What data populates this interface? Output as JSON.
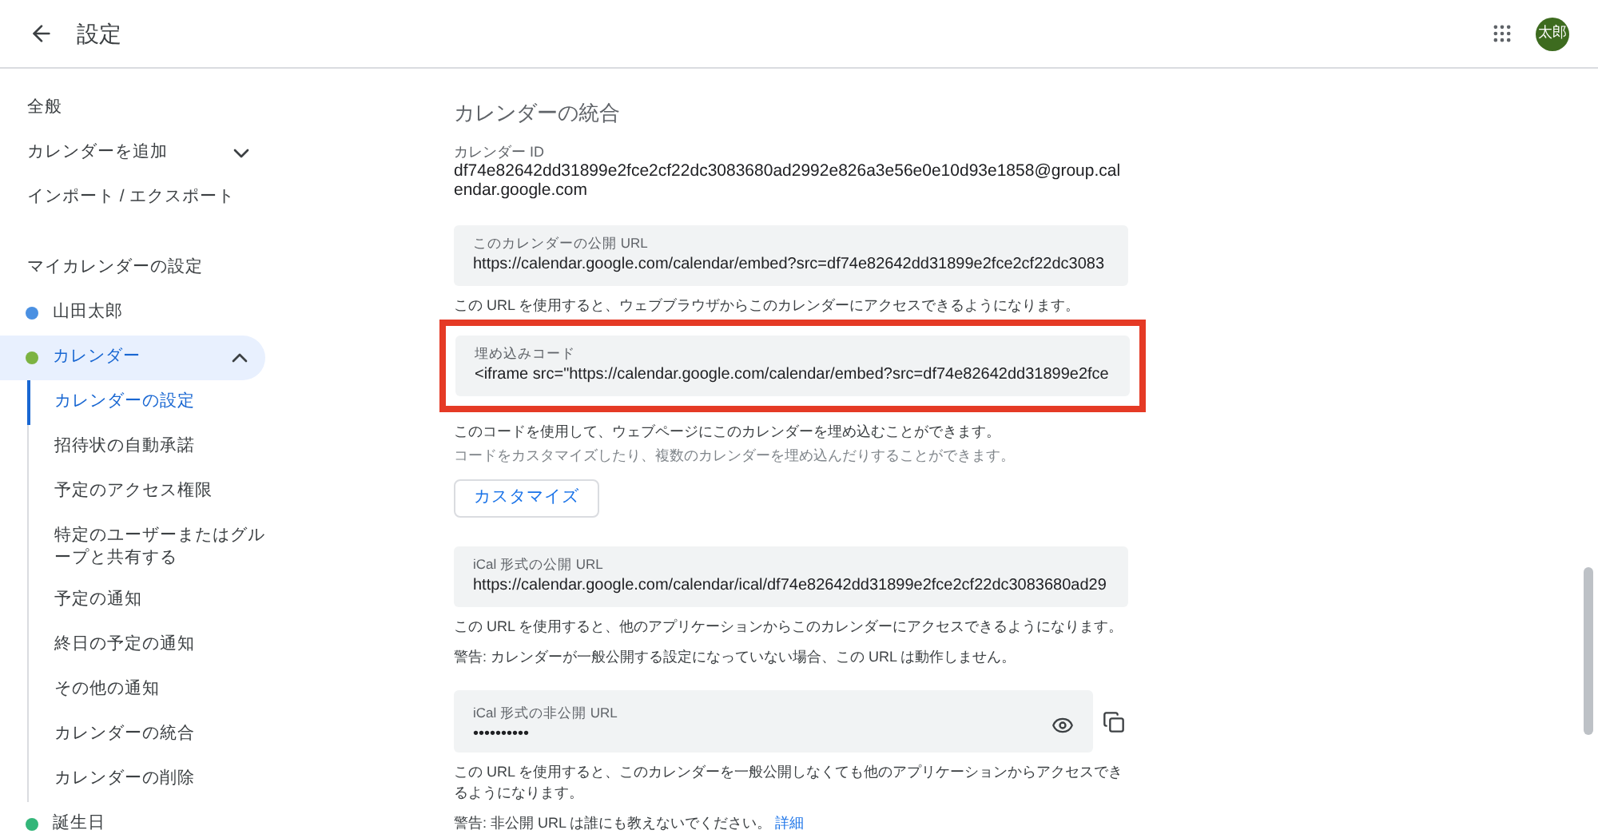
{
  "header": {
    "title": "設定",
    "avatar": "太郎"
  },
  "sidebar": {
    "top_items": [
      {
        "label": "全般"
      },
      {
        "label": "カレンダーを追加",
        "expanded": false
      },
      {
        "label": "インポート / エクスポート"
      }
    ],
    "section_title": "マイカレンダーの設定",
    "calendars": [
      {
        "label": "山田太郎",
        "color": "#4a90e2",
        "selected": false
      },
      {
        "label": "カレンダー",
        "color": "#7cb342",
        "selected": true,
        "expanded": true,
        "children": [
          {
            "label": "カレンダーの設定",
            "selected": true
          },
          {
            "label": "招待状の自動承諾",
            "selected": false
          },
          {
            "label": "予定のアクセス権限",
            "selected": false
          },
          {
            "label": "特定のユーザーまたはグループと共有する",
            "selected": false
          },
          {
            "label": "予定の通知",
            "selected": false
          },
          {
            "label": "終日の予定の通知",
            "selected": false
          },
          {
            "label": "その他の通知",
            "selected": false
          },
          {
            "label": "カレンダーの統合",
            "selected": false
          },
          {
            "label": "カレンダーの削除",
            "selected": false
          }
        ]
      },
      {
        "label": "誕生日",
        "color": "#33b679",
        "selected": false
      }
    ]
  },
  "content": {
    "title": "カレンダーの統合",
    "blocks": [
      {
        "kind": "info",
        "label": "カレンダー ID",
        "value": "df74e82642dd31899e2fce2cf22dc3083680ad2992e826a3e56e0e10d93e1858@group.calendar.google.com"
      },
      {
        "kind": "field",
        "label": "このカレンダーの公開 URL",
        "value": "https://calendar.google.com/calendar/embed?src=df74e82642dd31899e2fce2cf22dc3083",
        "highlighted": false
      },
      {
        "kind": "note",
        "text": "この URL を使用すると、ウェブブラウザからこのカレンダーにアクセスできるようになります。"
      },
      {
        "kind": "field",
        "label": "埋め込みコード",
        "value": "<iframe src=\"https://calendar.google.com/calendar/embed?src=df74e82642dd31899e2fce",
        "highlighted": true
      },
      {
        "kind": "note",
        "text": "このコードを使用して、ウェブページにこのカレンダーを埋め込むことができます。"
      },
      {
        "kind": "subnote",
        "text": "コードをカスタマイズしたり、複数のカレンダーを埋め込んだりすることができます。"
      },
      {
        "kind": "button",
        "label": "カスタマイズ"
      },
      {
        "kind": "field",
        "label": "iCal 形式の公開 URL",
        "value": "https://calendar.google.com/calendar/ical/df74e82642dd31899e2fce2cf22dc3083680ad29",
        "highlighted": false
      },
      {
        "kind": "note",
        "text": "この URL を使用すると、他のアプリケーションからこのカレンダーにアクセスできるようになります。"
      },
      {
        "kind": "note",
        "text": "警告: カレンダーが一般公開する設定になっていない場合、この URL は動作しません。"
      },
      {
        "kind": "secret",
        "label": "iCal 形式の非公開 URL",
        "value": "••••••••••"
      },
      {
        "kind": "note",
        "text": "この URL を使用すると、このカレンダーを一般公開しなくても他のアプリケーションからアクセスできるようになります。"
      },
      {
        "kind": "note",
        "text": "警告: 非公開 URL は誰にも教えないでください。",
        "link": "詳細"
      }
    ]
  }
}
